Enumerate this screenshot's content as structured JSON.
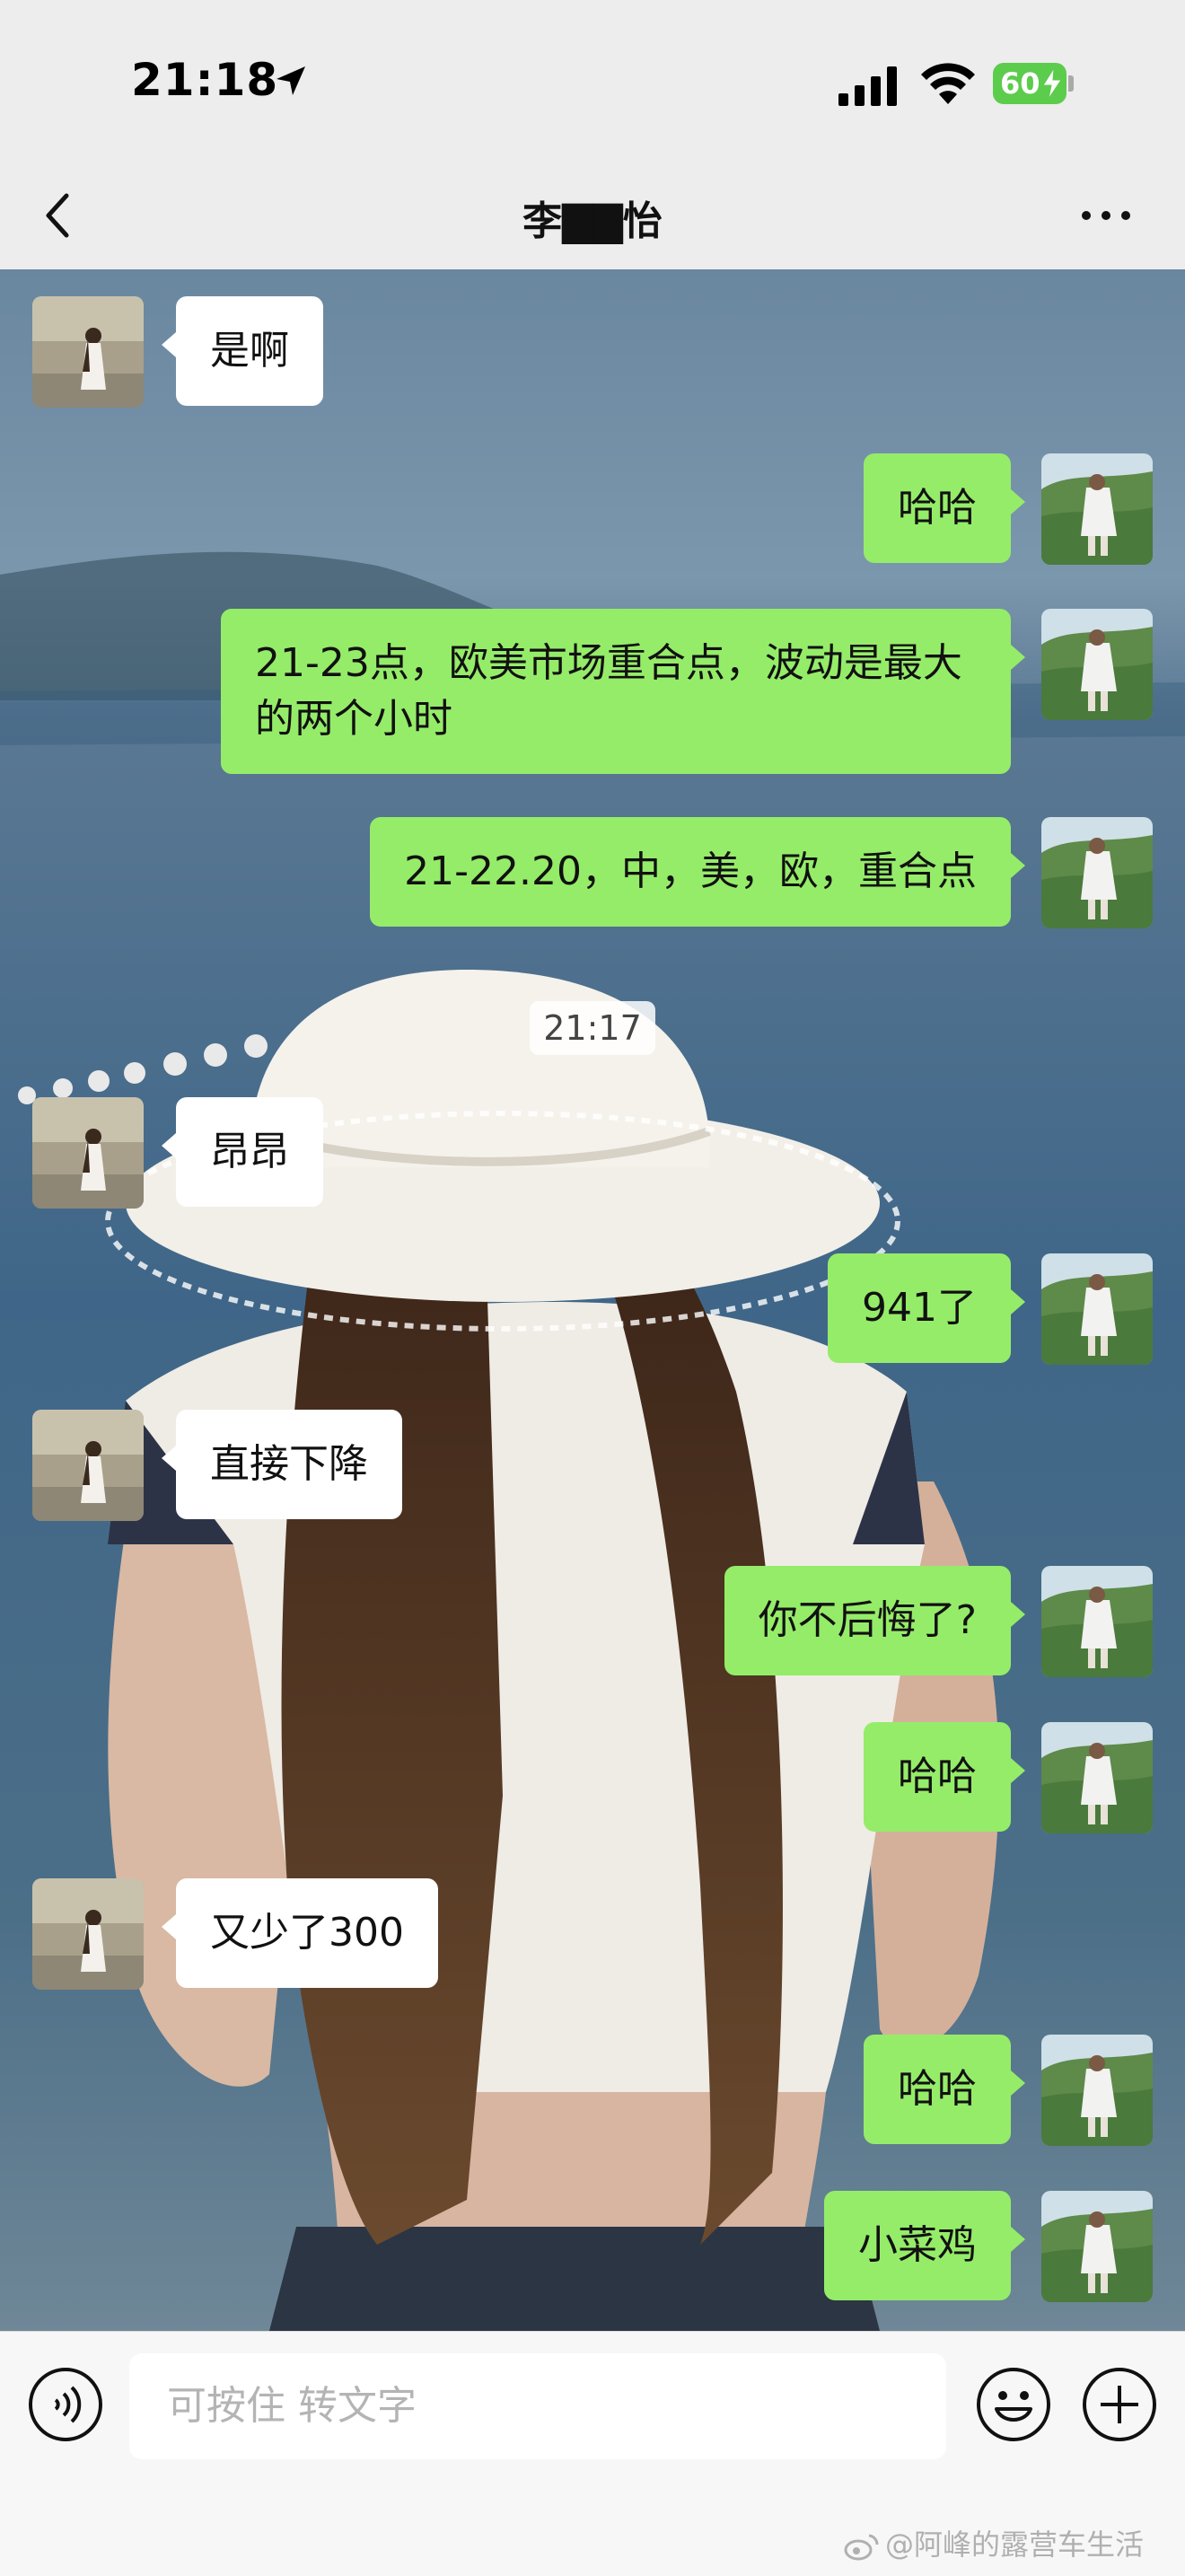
{
  "status_bar": {
    "time": "21:18",
    "battery": "60",
    "icons": [
      "location-arrow-icon",
      "signal-icon",
      "wifi-icon",
      "battery-charging-icon"
    ]
  },
  "nav": {
    "back_icon": "chevron-left-icon",
    "title": "李▇▇怡",
    "more_icon": "more-dots-icon"
  },
  "messages": [
    {
      "side": "in",
      "text": "是啊"
    },
    {
      "side": "out",
      "text": "哈哈"
    },
    {
      "side": "out",
      "text": "21-23点，欧美市场重合点，波动是最大的两个小时"
    },
    {
      "side": "out",
      "text": "21-22.20，中，美，欧，重合点"
    },
    {
      "side": "time",
      "text": "21:17"
    },
    {
      "side": "in",
      "text": "昂昂"
    },
    {
      "side": "out",
      "text": "941了"
    },
    {
      "side": "in",
      "text": "直接下降"
    },
    {
      "side": "out",
      "text": "你不后悔了?"
    },
    {
      "side": "out",
      "text": "哈哈"
    },
    {
      "side": "in",
      "text": "又少了300"
    },
    {
      "side": "out",
      "text": "哈哈"
    },
    {
      "side": "out",
      "text": "小菜鸡"
    }
  ],
  "input_bar": {
    "placeholder": "可按住 转文字",
    "icons": [
      "voice-icon",
      "emoji-icon",
      "plus-icon"
    ]
  },
  "watermark": "@阿峰的露营车生活",
  "colors": {
    "outgoing_bubble": "#95ec69",
    "incoming_bubble": "#ffffff",
    "background": "#ededed",
    "battery": "#5ccc4c"
  }
}
